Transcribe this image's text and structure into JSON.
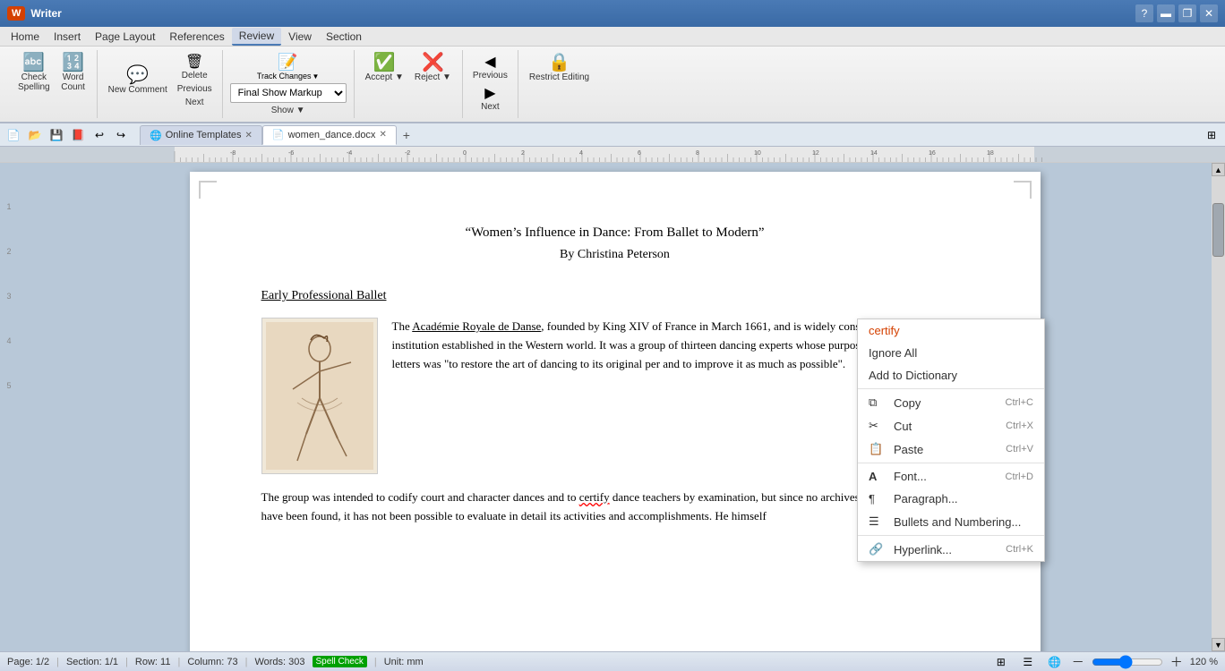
{
  "titlebar": {
    "app_icon": "W",
    "app_name": "Writer",
    "controls": [
      "▲",
      "▬",
      "❐",
      "✕"
    ]
  },
  "menubar": {
    "items": [
      "Home",
      "Insert",
      "Page Layout",
      "References",
      "Review",
      "View",
      "Section"
    ]
  },
  "ribbon": {
    "spelling_btn": "ABC\nCheck\nSpelling",
    "word_count_btn": "123\nABC\nWord\nCount",
    "new_comment_btn": "New\nComment",
    "delete_label": "Delete",
    "previous_track_label": "Previous",
    "next_track_label": "Next",
    "track_changes_label": "Track\nChanges",
    "track_dropdown_value": "Final Show Markup",
    "show_label": "Show",
    "accept_label": "Accept",
    "reject_label": "Reject",
    "previous_label": "Previous",
    "next_label": "Next",
    "restrict_label": "Restrict Editing"
  },
  "toolbar": {
    "tabs": [
      {
        "icon": "🌐",
        "label": "Online Templates",
        "closable": true,
        "active": false
      },
      {
        "icon": "📄",
        "label": "women_dance.docx",
        "closable": true,
        "active": true
      }
    ],
    "add_tab": "+"
  },
  "document": {
    "title": "“Women’s Influence in Dance: From Ballet to Modern”",
    "author": "By Christina Peterson",
    "section_heading": "Early Professional Ballet",
    "paragraph1": "The Académie Royale de Danse, founded by King XIV of France in March 1661, and is widely considered the first dance institution established in the Western world. It was a group of thirteen dancing experts whose purpose according to the letters was \"to restore the art of dancing to its original per and to improve it as much as possible\".",
    "paragraph2": "The group was intended to codify court and character dances and to certify dance teachers by examination, but since no archives of the organization have been found, it has not been possible to evaluate in detail its activities and accomplishments. He himself"
  },
  "context_menu": {
    "items": [
      {
        "label": "certify",
        "type": "special",
        "icon": ""
      },
      {
        "label": "Ignore All",
        "type": "normal",
        "icon": ""
      },
      {
        "label": "Add to Dictionary",
        "type": "normal",
        "icon": ""
      },
      {
        "divider": true
      },
      {
        "label": "Copy",
        "type": "normal",
        "icon": "⧉",
        "shortcut": "Ctrl+C"
      },
      {
        "label": "Cut",
        "type": "normal",
        "icon": "✂",
        "shortcut": "Ctrl+X"
      },
      {
        "label": "Paste",
        "type": "normal",
        "icon": "📋",
        "shortcut": "Ctrl+V"
      },
      {
        "divider": true
      },
      {
        "label": "Font...",
        "type": "normal",
        "icon": "A",
        "shortcut": "Ctrl+D"
      },
      {
        "label": "Paragraph...",
        "type": "normal",
        "icon": "¶",
        "shortcut": ""
      },
      {
        "label": "Bullets and Numbering...",
        "type": "normal",
        "icon": "☰",
        "shortcut": ""
      },
      {
        "divider": true
      },
      {
        "label": "Hyperlink...",
        "type": "normal",
        "icon": "🔗",
        "shortcut": "Ctrl+K"
      }
    ]
  },
  "statusbar": {
    "page": "Page: 1/2",
    "section": "Section: 1/1",
    "row": "Row: 11",
    "column": "Column: 73",
    "words": "Words: 303",
    "spell_check": "Spell Check",
    "unit": "Unit: mm",
    "zoom": "120 %"
  }
}
